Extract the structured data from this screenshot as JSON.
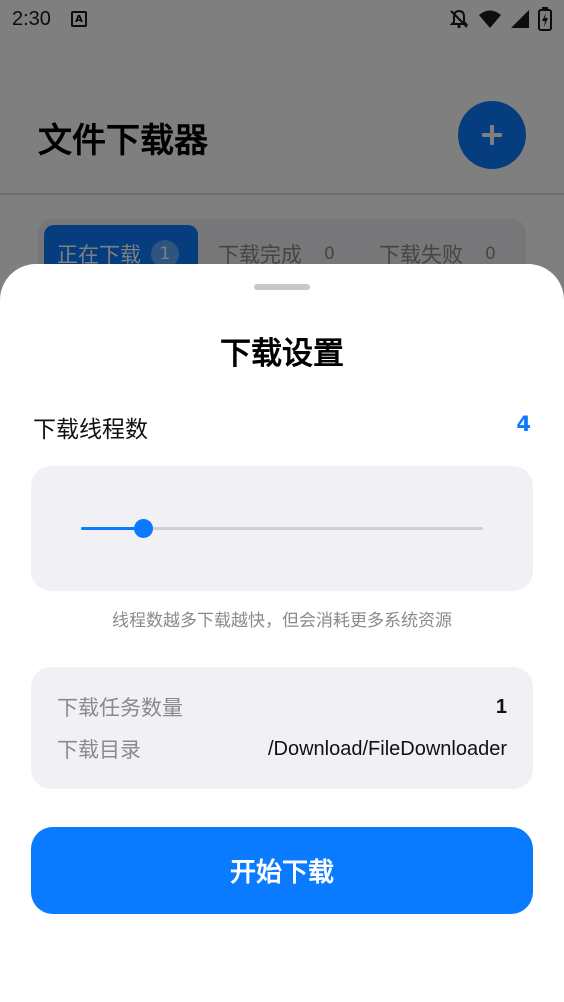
{
  "status_bar": {
    "time": "2:30",
    "icons": [
      "font-a-icon",
      "app-square-icon",
      "bell-off-icon",
      "wifi-icon",
      "signal-icon",
      "battery-charging-icon"
    ]
  },
  "app": {
    "title": "文件下载器",
    "fab_icon": "plus-icon",
    "tabs": [
      {
        "label": "正在下载",
        "count": "1"
      },
      {
        "label": "下载完成",
        "count": "0"
      },
      {
        "label": "下载失败",
        "count": "0"
      }
    ]
  },
  "sheet": {
    "title": "下载设置",
    "threads": {
      "label": "下载线程数",
      "value": "4",
      "slider_fraction": 0.155
    },
    "hint": "线程数越多下载越快，但会消耗更多系统资源",
    "info": [
      {
        "label": "下载任务数量",
        "value": "1"
      },
      {
        "label": "下载目录",
        "value": "/Download/FileDownloader"
      }
    ],
    "start_button": "开始下载"
  },
  "colors": {
    "accent": "#0a7aff",
    "card_bg": "#f1f1f5",
    "muted_text": "#8a8a8e"
  }
}
